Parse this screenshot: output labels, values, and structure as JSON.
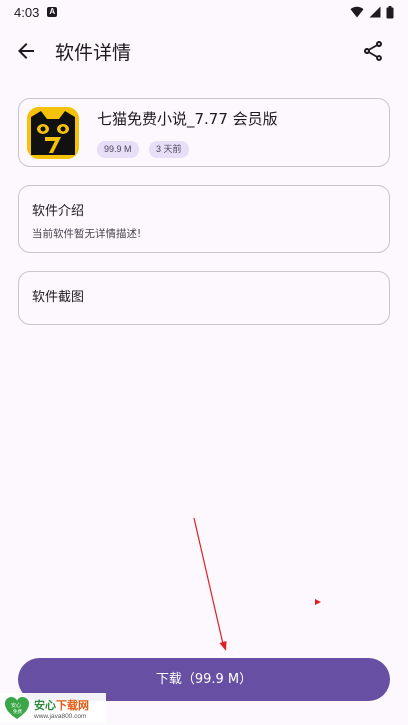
{
  "status_bar": {
    "time": "4:03",
    "a_badge": "A",
    "icons": [
      "wifi-icon",
      "signal-icon",
      "battery-icon"
    ]
  },
  "app_bar": {
    "title": "软件详情",
    "back_icon": "arrow-back-icon",
    "share_icon": "share-icon"
  },
  "app_info": {
    "name": "七猫免费小说_7.77 会员版",
    "size": "99.9 M",
    "date": "3 天前",
    "icon": "black-cat-logo-icon"
  },
  "intro": {
    "title": "软件介绍",
    "description": "当前软件暂无详情描述!"
  },
  "screenshots": {
    "title": "软件截图"
  },
  "download": {
    "label": "下载（99.9 M）"
  },
  "watermark": {
    "logo_text_top": "安心",
    "logo_text_bottom": "免费",
    "title_part1": "安心",
    "title_part2": "下载网",
    "url": "www.java800.com"
  },
  "colors": {
    "background": "#fdf7fe",
    "primary": "#6750a4",
    "chip": "#e8def8",
    "outline": "#cbc4cf",
    "annotation_arrow": "#e02020"
  }
}
